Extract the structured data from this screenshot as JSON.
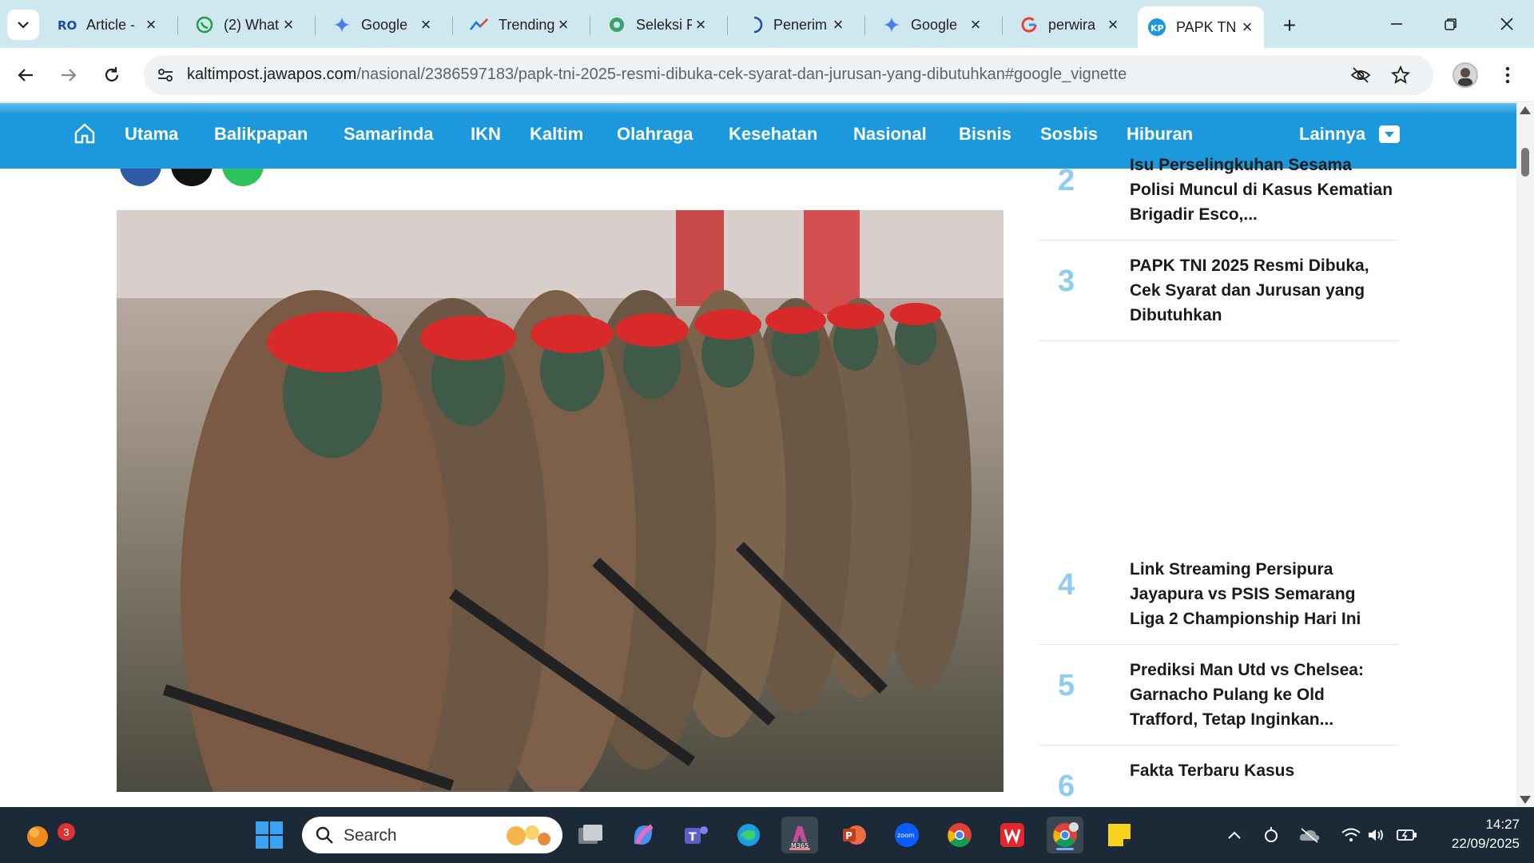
{
  "tabs": [
    {
      "title": "Article -",
      "icon": "ro-logo-icon"
    },
    {
      "title": "(2) What",
      "icon": "whatsapp-icon"
    },
    {
      "title": "Google",
      "icon": "gemini-icon"
    },
    {
      "title": "Trending",
      "icon": "trending-chart-icon"
    },
    {
      "title": "Seleksi P",
      "icon": "gear-badge-icon"
    },
    {
      "title": "Penerim",
      "icon": "loading-spinner-icon"
    },
    {
      "title": "Google",
      "icon": "gemini-icon"
    },
    {
      "title": "perwira",
      "icon": "google-g-icon"
    },
    {
      "title": "PAPK TN",
      "icon": "jawapos-logo-icon",
      "active": true
    }
  ],
  "address_bar": {
    "domain": "kaltimpost.jawapos.com",
    "path": "/nasional/2386597183/papk-tni-2025-resmi-dibuka-cek-syarat-dan-jurusan-yang-dibutuhkan#google_vignette"
  },
  "site_nav": {
    "items": [
      "Utama",
      "Balikpapan",
      "Samarinda",
      "IKN",
      "Kaltim",
      "Olahraga",
      "Kesehatan",
      "Nasional",
      "Bisnis",
      "Sosbis",
      "Hiburan"
    ],
    "more": "Lainnya",
    "color": "#1c98dc"
  },
  "trending": [
    {
      "num": "2",
      "title": "Isu Perselingkuhan Sesama Polisi Muncul di Kasus Kematian Brigadir Esco,..."
    },
    {
      "num": "3",
      "title": "PAPK TNI 2025 Resmi Dibuka, Cek Syarat dan Jurusan yang Dibutuhkan"
    },
    {
      "num": "4",
      "title": "Link Streaming Persipura Jayapura vs PSIS Semarang Liga 2 Championship Hari Ini"
    },
    {
      "num": "5",
      "title": "Prediksi Man Utd vs Chelsea: Garnacho Pulang ke Old Trafford, Tetap Inginkan..."
    },
    {
      "num": "6",
      "title": "Fakta Terbaru Kasus"
    }
  ],
  "taskbar": {
    "search_label": "Search",
    "notification_count": "3",
    "time": "14:27",
    "date": "22/09/2025"
  }
}
